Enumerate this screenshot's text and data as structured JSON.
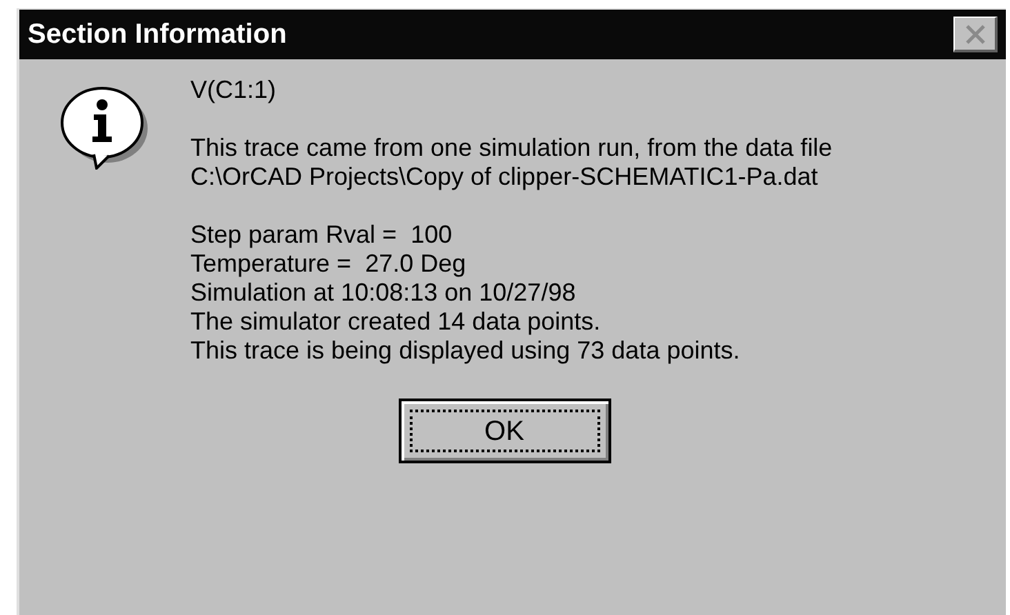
{
  "window": {
    "title": "Section Information"
  },
  "trace": "V(C1:1)",
  "paragraphs": [
    [
      "This trace came from one simulation run, from the data file",
      "C:\\OrCAD Projects\\Copy of clipper-SCHEMATIC1-Pa.dat"
    ],
    [
      "Step param Rval =  100",
      "Temperature =  27.0 Deg",
      "Simulation at 10:08:13 on 10/27/98",
      "The simulator created 14 data points.",
      "This trace is being displayed using 73 data points."
    ]
  ],
  "button": {
    "label": "OK",
    "focused": true
  }
}
